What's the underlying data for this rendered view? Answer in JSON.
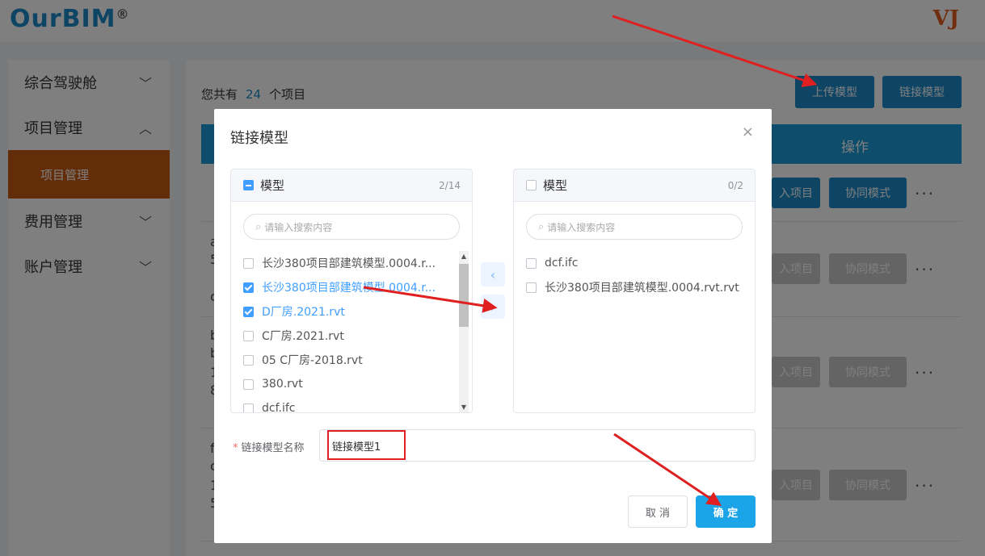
{
  "app": {
    "logo_main": "OurBIM",
    "logo_reg": "®",
    "user_mark": "VJ"
  },
  "sidebar": {
    "items": [
      {
        "label": "综合驾驶舱"
      },
      {
        "label": "项目管理"
      },
      {
        "label": "项目管理"
      },
      {
        "label": "费用管理"
      },
      {
        "label": "账户管理"
      }
    ]
  },
  "content": {
    "count_prefix": "您共有",
    "count_value": "24",
    "count_suffix": "个项目",
    "upload_button": "上传模型",
    "link_button": "链接模型",
    "operation_header": "操作",
    "enter_project": "入项目",
    "collab_mode": "协同模式",
    "more": "···",
    "row_fragments": [
      "a",
      "5",
      "c",
      "b",
      "b",
      "1",
      "8",
      "f",
      "c",
      "1",
      "5"
    ]
  },
  "modal": {
    "title": "链接模型",
    "close": "×",
    "left_panel": {
      "title": "模型",
      "count": "2/14",
      "search_placeholder": "请输入搜索内容",
      "items": [
        {
          "label": "长沙380项目部建筑模型.0004.r...",
          "checked": false
        },
        {
          "label": "长沙380项目部建筑模型.0004.r...",
          "checked": true
        },
        {
          "label": "D厂房.2021.rvt",
          "checked": true
        },
        {
          "label": "C厂房.2021.rvt",
          "checked": false
        },
        {
          "label": "05 C厂房-2018.rvt",
          "checked": false
        },
        {
          "label": "380.rvt",
          "checked": false
        },
        {
          "label": "dcf.ifc",
          "checked": false
        }
      ]
    },
    "right_panel": {
      "title": "模型",
      "count": "0/2",
      "search_placeholder": "请输入搜索内容",
      "items": [
        {
          "label": "dcf.ifc",
          "checked": false
        },
        {
          "label": "长沙380项目部建筑模型.0004.rvt.rvt",
          "checked": false
        }
      ]
    },
    "transfer_left": "‹",
    "transfer_right": "›",
    "name_field": {
      "required_mark": "*",
      "label": "链接模型名称",
      "value": "链接模型1"
    },
    "cancel_button": "取 消",
    "confirm_button": "确 定"
  },
  "colors": {
    "brand_blue": "#1d8bc9",
    "brand_orange": "#c85a14",
    "checkbox_blue": "#409eff",
    "annotation_red": "#e02020"
  }
}
